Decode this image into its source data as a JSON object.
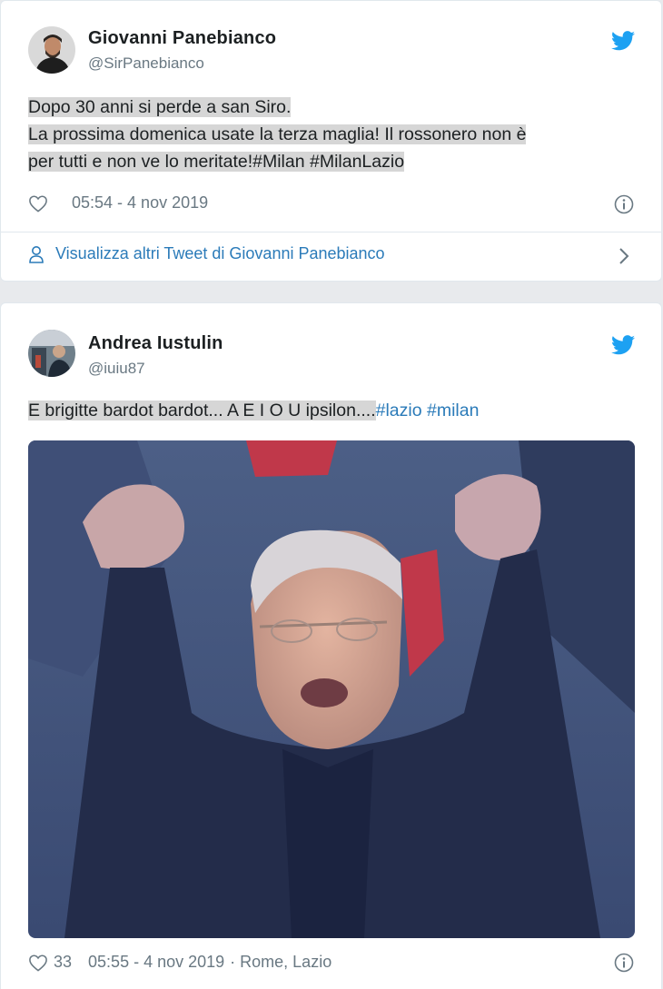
{
  "tweets": [
    {
      "name": "Giovanni Panebianco",
      "handle": "@SirPanebianco",
      "lines": [
        "Dopo 30 anni si perde a san Siro.",
        "La prossima domenica usate la terza maglia! Il rossonero non è",
        "per tutti e non ve lo meritate!#Milan #MilanLazio"
      ],
      "likes": "",
      "timestamp": "05:54 - 4 nov 2019",
      "more_tweets_label": "Visualizza altri Tweet di Giovanni Panebianco",
      "icons": {
        "like": "heart-icon",
        "info": "info-icon",
        "brand": "twitter-bird-icon",
        "person": "person-icon",
        "chevron": "chevron-right-icon"
      }
    },
    {
      "name": "Andrea Iustulin",
      "handle": "@iuiu87",
      "text_plain": "E brigitte bardot bardot... A E I O U ipsilon....",
      "hashtags": "#lazio #milan",
      "likes": "33",
      "timestamp": "05:55 - 4 nov 2019",
      "location": "· Rome, Lazio",
      "media": "photo"
    }
  ],
  "colors": {
    "accent": "#1da1f2",
    "link": "#2b7bb9",
    "muted": "#697882",
    "highlight": "#d6d6d6"
  }
}
